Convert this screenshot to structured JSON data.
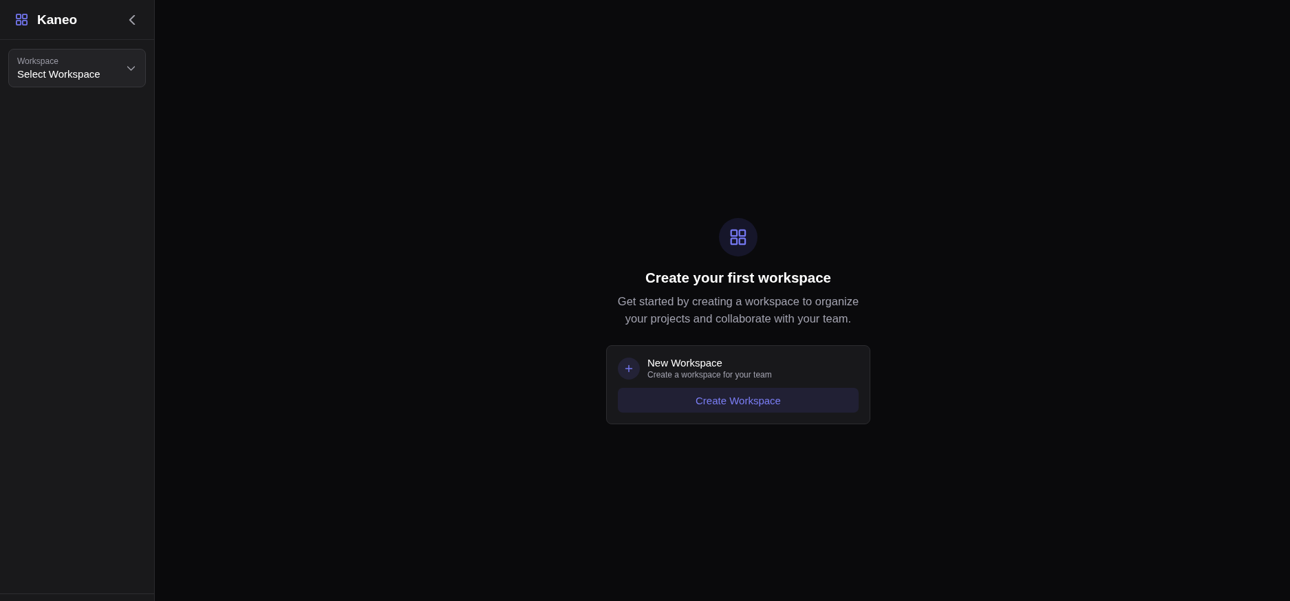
{
  "sidebar": {
    "brand": "Kaneo",
    "workspace_select": {
      "label": "Workspace",
      "value": "Select Workspace"
    }
  },
  "empty_state": {
    "title": "Create your first workspace",
    "description": "Get started by creating a workspace to organize your projects and collaborate with your team.",
    "card": {
      "title": "New Workspace",
      "subtitle": "Create a workspace for your team",
      "button": "Create Workspace"
    }
  }
}
